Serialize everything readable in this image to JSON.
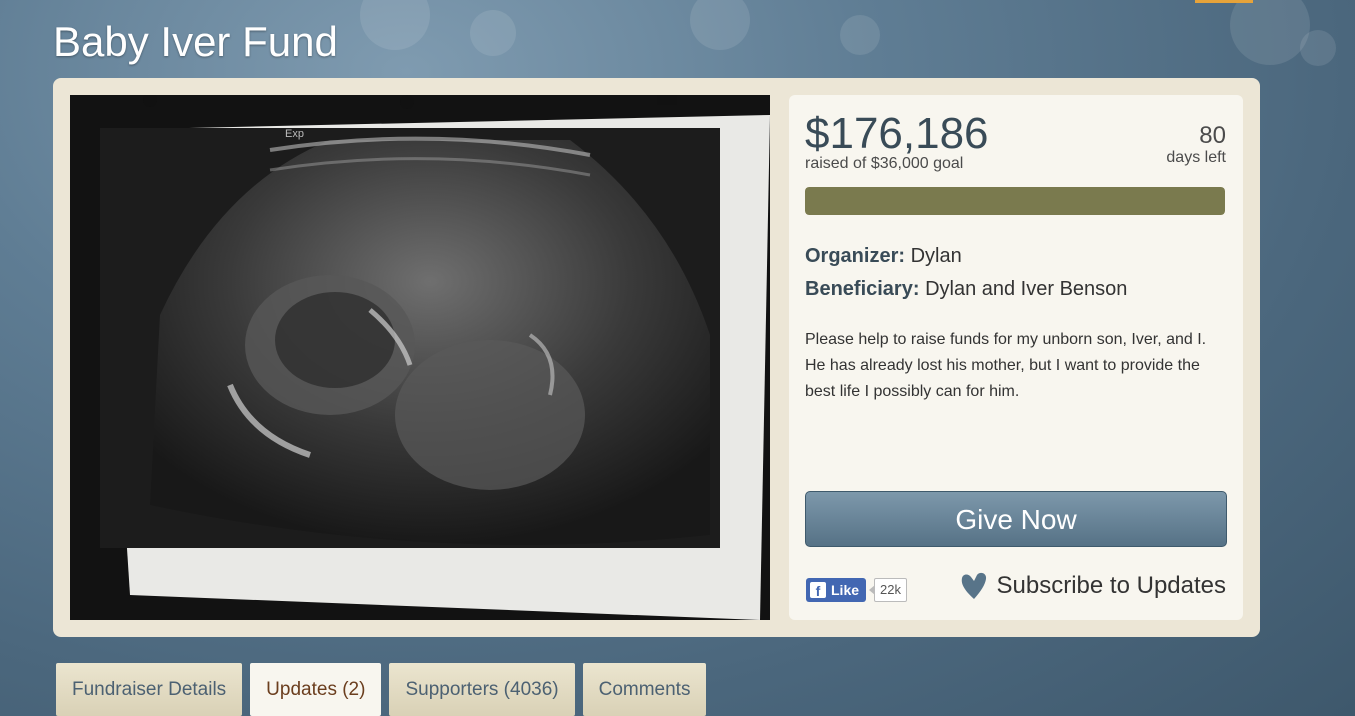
{
  "page": {
    "title": "Baby Iver Fund"
  },
  "campaign": {
    "amount_raised": "$176,186",
    "raised_text": "raised of $36,000 goal",
    "days_left_number": "80",
    "days_left_label": "days left",
    "progress_fraction": 1.0,
    "organizer_label": "Organizer:",
    "organizer_name": "Dylan",
    "beneficiary_label": "Beneficiary:",
    "beneficiary_name": "Dylan and Iver Benson",
    "description": "Please help to raise funds for my unborn son, Iver, and I. He has already lost his mother, but I want to provide the best life I possibly can for him.",
    "give_button_label": "Give Now",
    "facebook_like_label": "Like",
    "facebook_like_count": "22k",
    "subscribe_label": "Subscribe to Updates"
  },
  "photo": {
    "caption_text": "Exp"
  },
  "tabs": [
    {
      "label": "Fundraiser Details",
      "active": false
    },
    {
      "label": "Updates (2)",
      "active": true
    },
    {
      "label": "Supporters (4036)",
      "active": false
    },
    {
      "label": "Comments",
      "active": false
    }
  ],
  "colors": {
    "progress_fill": "#7a7a4e",
    "button": "#5f7b8f",
    "panel": "#ece6d6",
    "background": "#56748a"
  },
  "icons": {
    "facebook": "facebook-icon",
    "subscribe": "heart-icon"
  }
}
